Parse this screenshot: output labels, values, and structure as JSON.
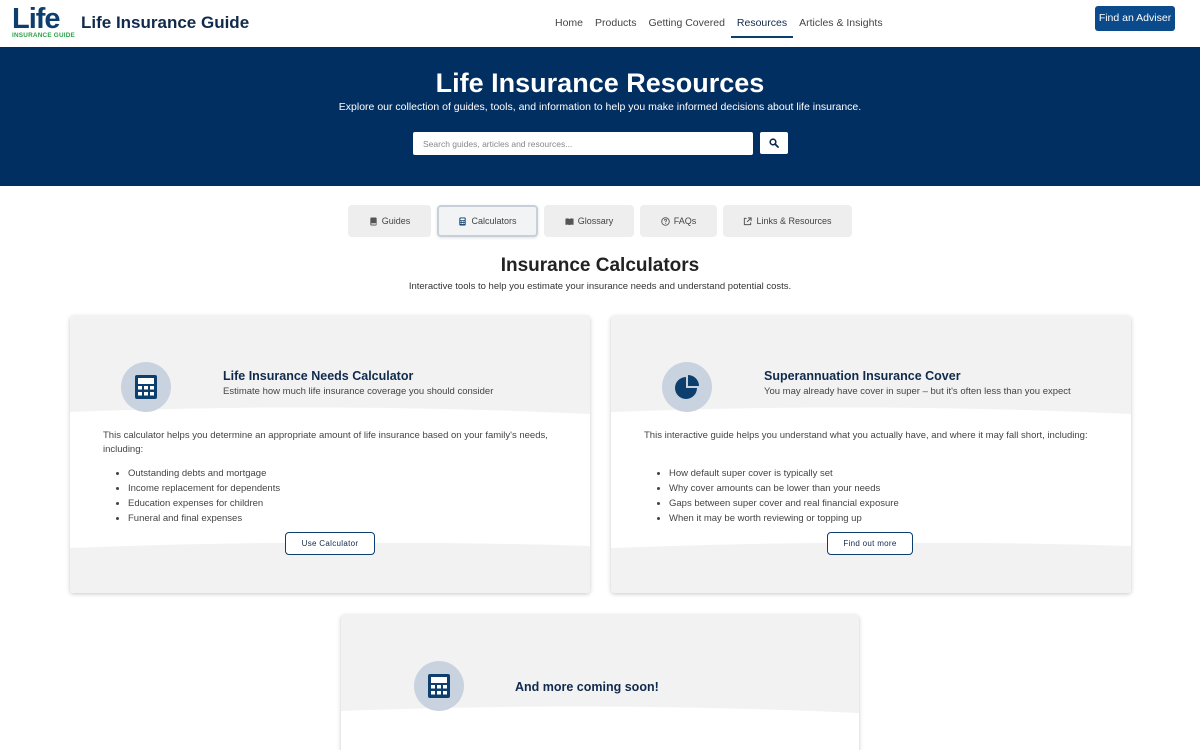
{
  "header": {
    "logo_word": "Life",
    "logo_sub": "INSURANCE GUIDE",
    "brand_title": "Life Insurance Guide",
    "nav": [
      "Home",
      "Products",
      "Getting Covered",
      "Resources",
      "Articles & Insights"
    ],
    "active_nav": "Resources",
    "cta_label": "Find an Adviser"
  },
  "hero": {
    "title": "Life Insurance Resources",
    "subtitle": "Explore our collection of guides, tools, and information to help you make informed decisions about life insurance.",
    "search_placeholder": "Search guides, articles and resources..."
  },
  "tabs": [
    {
      "label": "Guides",
      "icon": "book-icon"
    },
    {
      "label": "Calculators",
      "icon": "calculator-icon"
    },
    {
      "label": "Glossary",
      "icon": "open-book-icon"
    },
    {
      "label": "FAQs",
      "icon": "question-circle-icon"
    },
    {
      "label": "Links & Resources",
      "icon": "external-link-icon"
    }
  ],
  "active_tab": "Calculators",
  "section": {
    "title": "Insurance Calculators",
    "subtitle": "Interactive tools to help you estimate your insurance needs and understand potential costs."
  },
  "cards": [
    {
      "icon": "calculator-icon",
      "title": "Life Insurance Needs Calculator",
      "subtitle": "Estimate how much life insurance coverage you should consider",
      "description": "This calculator helps you determine an appropriate amount of life insurance based on your family's needs, including:",
      "items": [
        "Outstanding debts and mortgage",
        "Income replacement for dependents",
        "Education expenses for children",
        "Funeral and final expenses"
      ],
      "button": "Use Calculator"
    },
    {
      "icon": "pie-chart-icon",
      "title": "Superannuation Insurance Cover",
      "subtitle": "You may already have cover in super – but it's often less than you expect",
      "description": "This interactive guide helps you understand what you actually have, and where it may fall short, including:",
      "items": [
        "How default super cover is typically set",
        "Why cover amounts can be lower than your needs",
        "Gaps between super cover and real financial exposure",
        "When it may be worth reviewing or topping up"
      ],
      "button": "Find out more"
    },
    {
      "icon": "calculator-icon",
      "title": "And more coming soon!"
    }
  ],
  "colors": {
    "hero_bg": "#022f62",
    "brand_navy": "#102a4c",
    "cta_blue": "#0b4a8b",
    "logo_green": "#2ea04a",
    "icon_circle": "#c9d3e0"
  }
}
